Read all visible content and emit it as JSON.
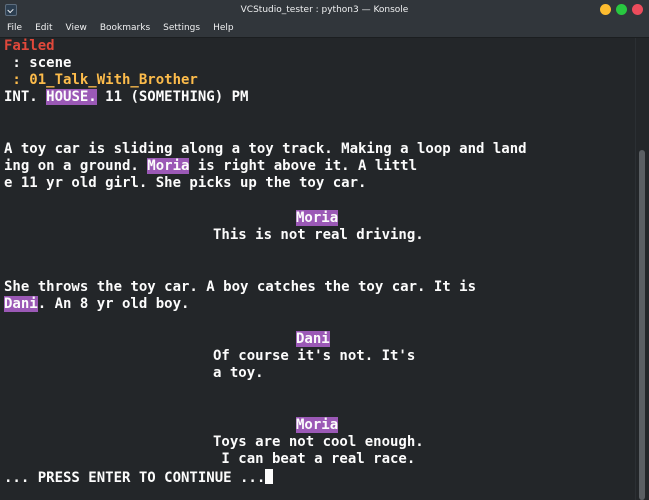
{
  "window": {
    "title": "VCStudio_tester : python3 — Konsole"
  },
  "menu": [
    "File",
    "Edit",
    "View",
    "Bookmarks",
    "Settings",
    "Help"
  ],
  "terminal": {
    "failed": "Failed",
    "scene_key": " : scene",
    "scene_name": " : 01_Talk_With_Brother",
    "heading_prefix": "INT. ",
    "heading_location": "HOUSE.",
    "heading_suffix": " 11 (SOMETHING) PM",
    "action1_line1": "A toy car is sliding along a toy track. Making a loop and land",
    "action1_line2_prefix": "ing on a ground. ",
    "action1_line2_name": "Moria",
    "action1_line2_suffix": " is right above it. A littl",
    "action1_line3": "e 11 yr old girl. She picks up the toy car.",
    "char1": "Moria",
    "dialogue1": "This is not real driving.",
    "action2_line1": "She throws the toy car. A boy catches the toy car. It is",
    "action2_line2_name": "Dani",
    "action2_line2_suffix": ". An 8 yr old boy.",
    "char2": "Dani",
    "dialogue2_line1": "Of course it's not. It's",
    "dialogue2_line2": "a toy.",
    "char3": "Moria",
    "dialogue3_line1": "Toys are not cool enough.",
    "dialogue3_line2": " I can beat a real race.",
    "prompt": "... PRESS ENTER TO CONTINUE ..."
  },
  "colors": {
    "background": "#232629",
    "text": "#fcfcfc",
    "failed": "#e0483b",
    "scene": "#fdbc4b",
    "highlight": "#9b59b6"
  }
}
